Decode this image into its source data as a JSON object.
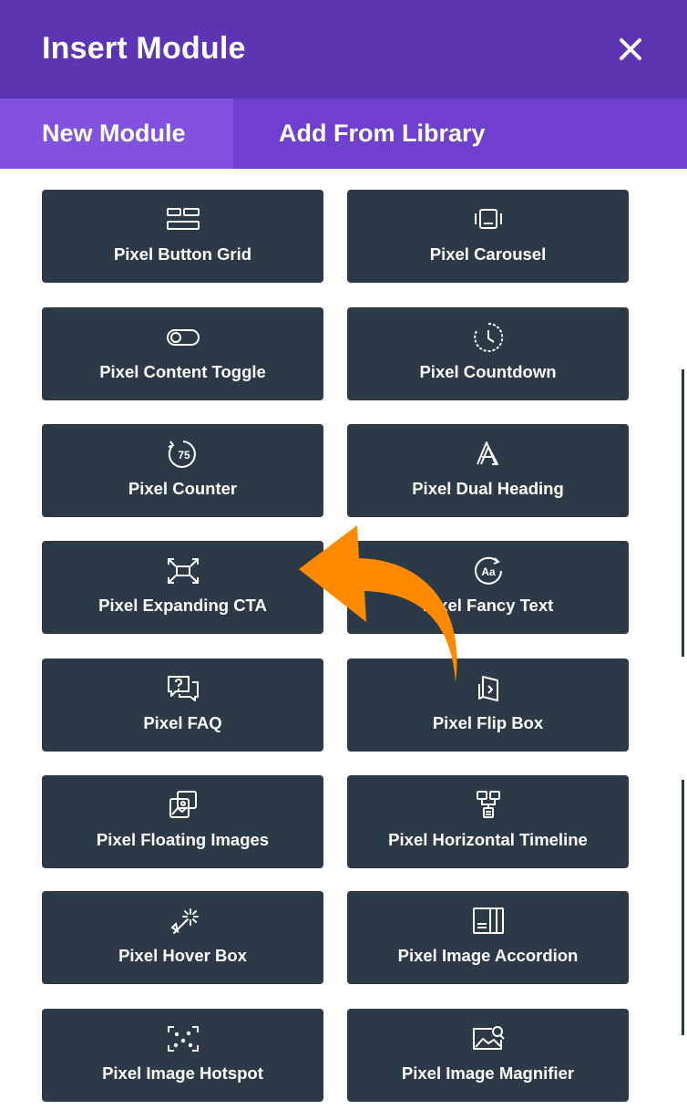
{
  "header": {
    "title": "Insert Module",
    "close_icon": "close-icon"
  },
  "tabs": [
    {
      "label": "New Module",
      "active": true
    },
    {
      "label": "Add From Library",
      "active": false
    }
  ],
  "modules": [
    {
      "label": "Pixel Button Grid",
      "icon": "button-grid-icon"
    },
    {
      "label": "Pixel Carousel",
      "icon": "carousel-icon"
    },
    {
      "label": "Pixel Content Toggle",
      "icon": "toggle-icon"
    },
    {
      "label": "Pixel Countdown",
      "icon": "clock-icon"
    },
    {
      "label": "Pixel Counter",
      "icon": "counter-icon",
      "icon_text": "75"
    },
    {
      "label": "Pixel Dual Heading",
      "icon": "dual-heading-icon"
    },
    {
      "label": "Pixel Expanding CTA",
      "icon": "expand-icon"
    },
    {
      "label": "Pixel Fancy Text",
      "icon": "fancy-text-icon",
      "icon_text": "Aa"
    },
    {
      "label": "Pixel FAQ",
      "icon": "faq-icon"
    },
    {
      "label": "Pixel Flip Box",
      "icon": "flip-box-icon"
    },
    {
      "label": "Pixel Floating Images",
      "icon": "floating-images-icon"
    },
    {
      "label": "Pixel Horizontal Timeline",
      "icon": "timeline-icon"
    },
    {
      "label": "Pixel Hover Box",
      "icon": "hover-wand-icon"
    },
    {
      "label": "Pixel Image Accordion",
      "icon": "image-accordion-icon"
    },
    {
      "label": "Pixel Image Hotspot",
      "icon": "hotspot-icon"
    },
    {
      "label": "Pixel Image Magnifier",
      "icon": "magnifier-icon"
    }
  ],
  "annotation": {
    "icon": "orange-curved-arrow-icon",
    "color": "#ff8a00"
  },
  "colors": {
    "header": "#5d35b3",
    "tabs_bar": "#6f3fcf",
    "active_tab": "#8152e0",
    "tile": "#2c3a47"
  }
}
